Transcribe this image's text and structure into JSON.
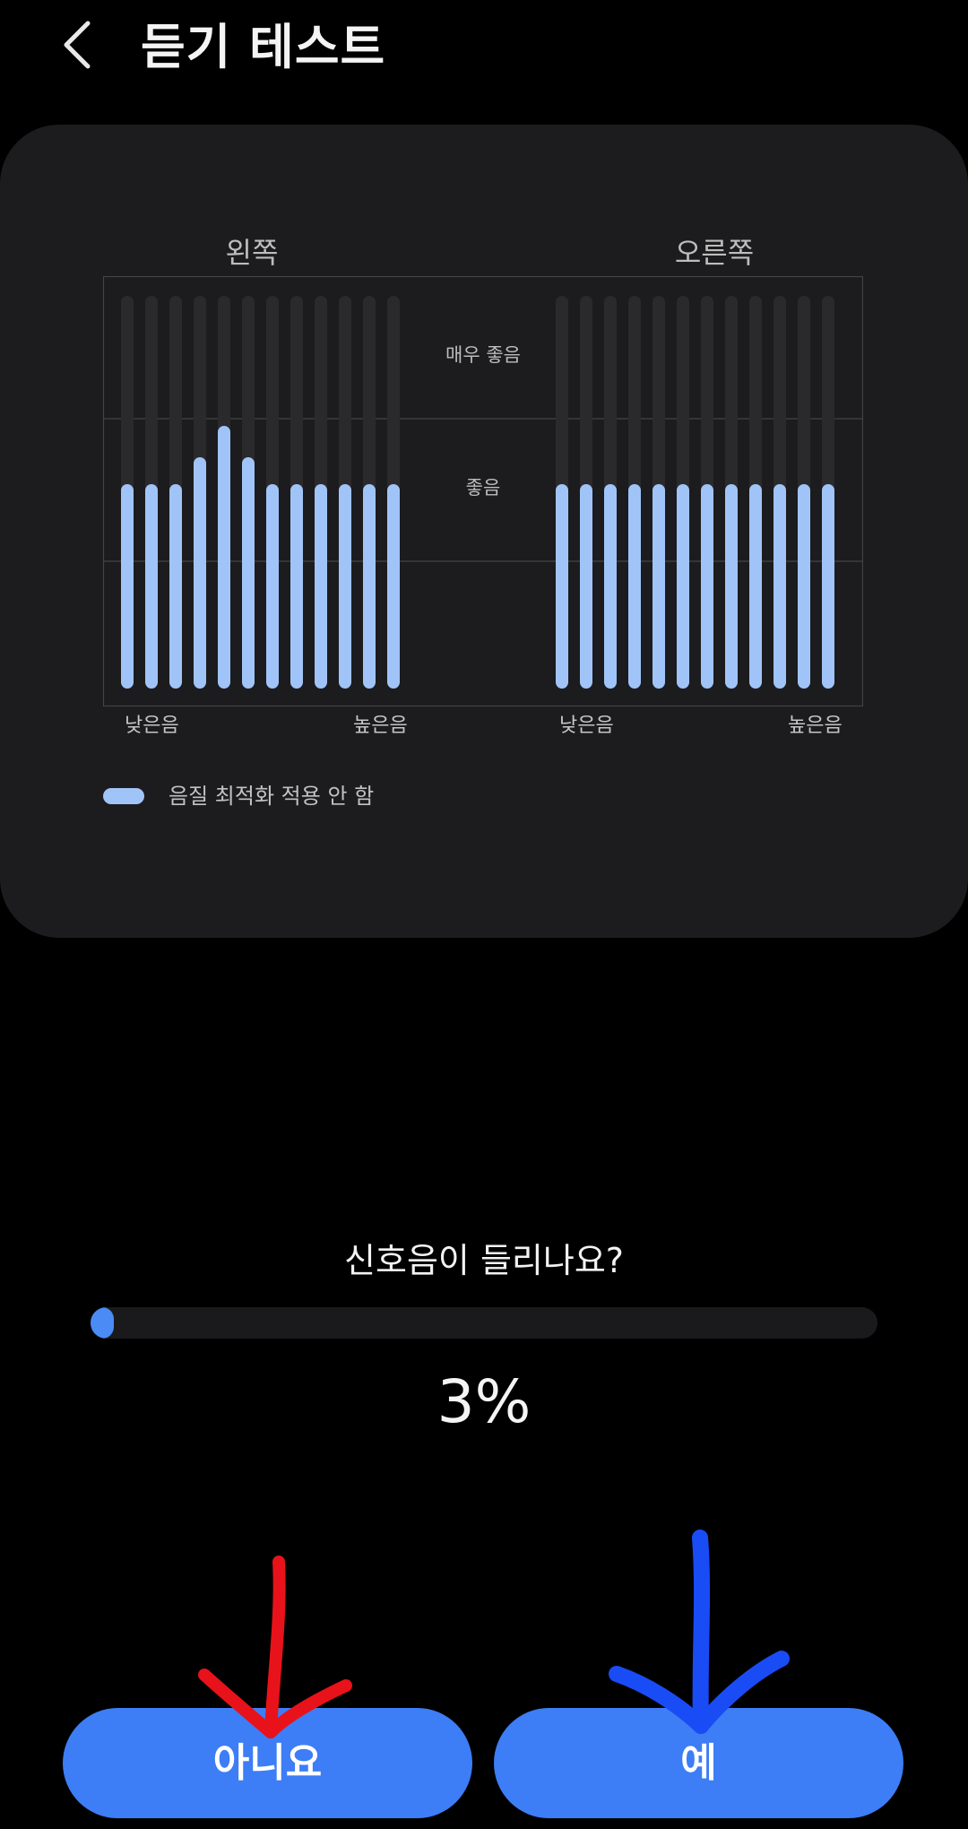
{
  "header": {
    "title": "듣기 테스트",
    "back_icon": "chevron-left-icon"
  },
  "card": {
    "left_label": "왼쪽",
    "right_label": "오른쪽",
    "legend_label": "음질 최적화 적용 안 함",
    "legend_color": "#a1c4f8",
    "tick_low": "낮은음",
    "tick_high": "높은음"
  },
  "chart_data": {
    "type": "bar",
    "levels": [
      "매우 좋음",
      "좋음"
    ],
    "colors": {
      "bar": "#a1c4f8",
      "track": "#2a2a2c",
      "grid": "#444444"
    },
    "series": [
      {
        "side": "왼쪽",
        "values": [
          0.52,
          0.52,
          0.52,
          0.59,
          0.67,
          0.59,
          0.52,
          0.52,
          0.52,
          0.52,
          0.52,
          0.52
        ]
      },
      {
        "side": "오른쪽",
        "values": [
          0.52,
          0.52,
          0.52,
          0.52,
          0.52,
          0.52,
          0.52,
          0.52,
          0.52,
          0.52,
          0.52,
          0.52
        ]
      }
    ],
    "ylim": [
      0,
      1
    ]
  },
  "question": {
    "text": "신호음이 들리나요?"
  },
  "progress": {
    "value": 0.03,
    "label": "3%",
    "color": "#4a8bf6"
  },
  "buttons": {
    "no_label": "아니요",
    "yes_label": "예",
    "color": "#3d7df6"
  },
  "annotations": {
    "red_arrow_color": "#e8121a",
    "blue_arrow_color": "#1a4cf5"
  }
}
